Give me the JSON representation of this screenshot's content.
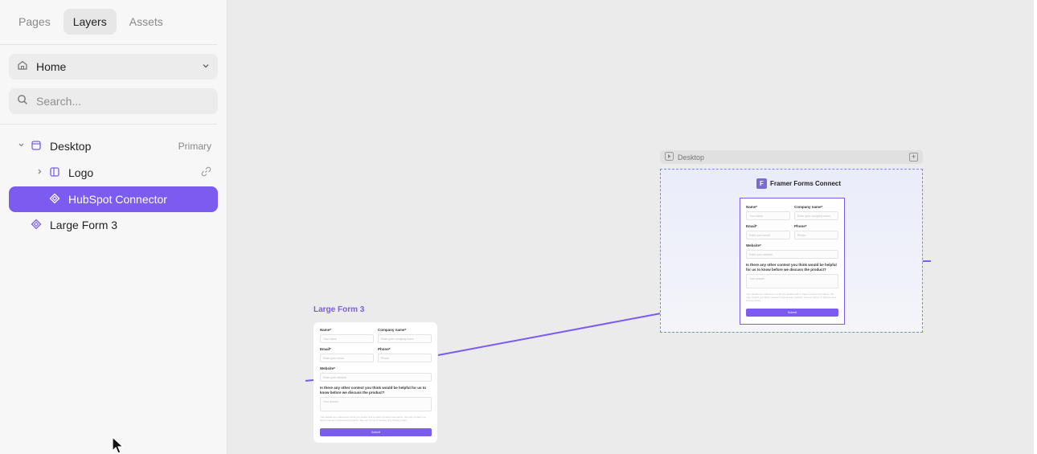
{
  "sidebar": {
    "tabs": [
      {
        "label": "Pages"
      },
      {
        "label": "Layers"
      },
      {
        "label": "Assets"
      }
    ],
    "page_select": {
      "label": "Home"
    },
    "search": {
      "placeholder": "Search..."
    },
    "layers": [
      {
        "label": "Desktop",
        "extra": "Primary"
      },
      {
        "label": "Logo"
      },
      {
        "label": "HubSpot Connector"
      },
      {
        "label": "Large Form 3"
      }
    ]
  },
  "canvas": {
    "desktop_frame": {
      "title": "Desktop",
      "brand": "Framer Forms Connect"
    },
    "large_form_label": "Large Form 3",
    "form": {
      "name_label": "Name*",
      "name_placeholder": "Your name",
      "company_label": "Company name*",
      "company_placeholder": "Enter your company name",
      "email_label": "Email*",
      "email_placeholder": "Enter your email",
      "phone_label": "Phone*",
      "phone_placeholder": "Phone",
      "website_label": "Website*",
      "website_placeholder": "Enter your website",
      "question_label": "Is there any other context you think would be helpful for us to know before we discuss the product?",
      "question_placeholder": "Your answer",
      "consent_text": "Your details are collected to send you details and to share product information. We may contact you about relevant content and products. See our Terms of Service and Privacy Policy.",
      "submit_label": "Submit"
    }
  },
  "colors": {
    "accent": "#7b5bf0",
    "frame_border": "#6f8fe8"
  }
}
